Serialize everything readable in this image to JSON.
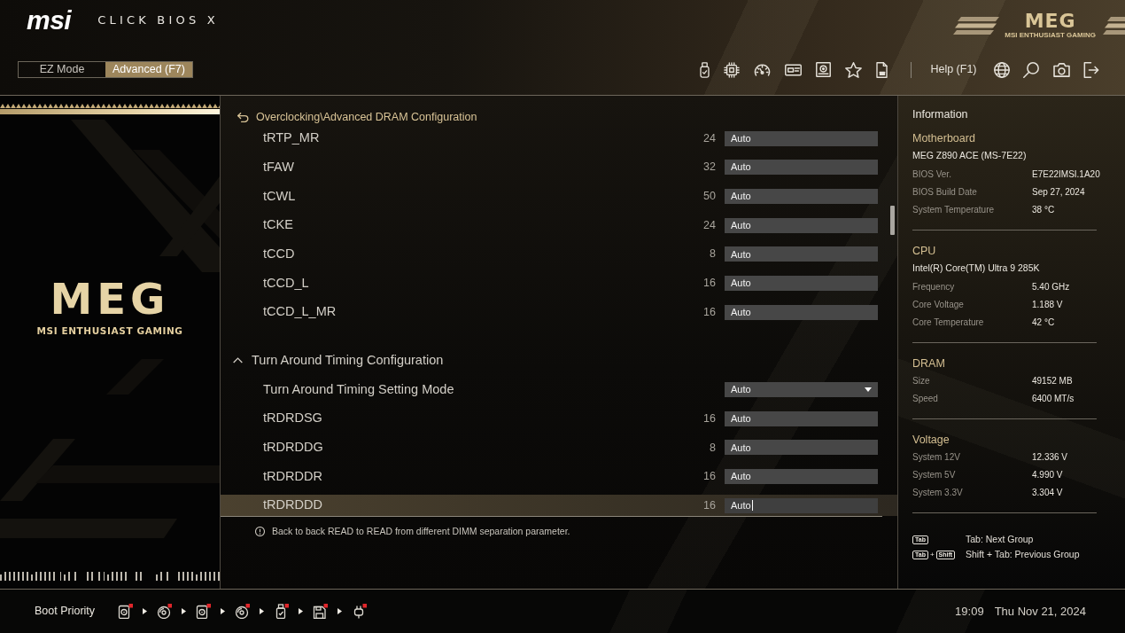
{
  "header": {
    "brand": "msi",
    "product": "CLICK BIOS X",
    "modes": [
      {
        "label": "EZ Mode",
        "selected": false
      },
      {
        "label": "Advanced (F7)",
        "selected": true
      }
    ],
    "help": "Help (F1)",
    "logo": {
      "mark": "MEG",
      "tagline": "MSI ENTHUSIAST GAMING"
    }
  },
  "side_panel": {
    "logo": {
      "mark": "MEG",
      "tagline": "MSI ENTHUSIAST GAMING"
    }
  },
  "breadcrumb": "Overclocking\\Advanced DRAM Configuration",
  "settings": [
    {
      "kind": "value",
      "label": "tRTP_MR",
      "current": "24",
      "value": "Auto",
      "selected": false
    },
    {
      "kind": "value",
      "label": "tFAW",
      "current": "32",
      "value": "Auto",
      "selected": false
    },
    {
      "kind": "value",
      "label": "tCWL",
      "current": "50",
      "value": "Auto",
      "selected": false
    },
    {
      "kind": "value",
      "label": "tCKE",
      "current": "24",
      "value": "Auto",
      "selected": false
    },
    {
      "kind": "value",
      "label": "tCCD",
      "current": "8",
      "value": "Auto",
      "selected": false
    },
    {
      "kind": "value",
      "label": "tCCD_L",
      "current": "16",
      "value": "Auto",
      "selected": false
    },
    {
      "kind": "value",
      "label": "tCCD_L_MR",
      "current": "16",
      "value": "Auto",
      "selected": false
    },
    {
      "kind": "group",
      "label": "Turn Around Timing Configuration",
      "expanded": true,
      "selected": false
    },
    {
      "kind": "dropdown",
      "label": "Turn Around Timing Setting Mode",
      "value": "Auto",
      "selected": false
    },
    {
      "kind": "value",
      "label": "tRDRDSG",
      "current": "16",
      "value": "Auto",
      "selected": false
    },
    {
      "kind": "value",
      "label": "tRDRDDG",
      "current": "8",
      "value": "Auto",
      "selected": false
    },
    {
      "kind": "value",
      "label": "tRDRDDR",
      "current": "16",
      "value": "Auto",
      "selected": false
    },
    {
      "kind": "value",
      "label": "tRDRDDD",
      "current": "16",
      "value": "Auto",
      "selected": true
    }
  ],
  "help_text": "Back to back READ to READ from different DIMM separation parameter.",
  "information": {
    "title": "Information",
    "sections": [
      {
        "title": "Motherboard",
        "subtitle": "MEG Z890 ACE (MS-7E22)",
        "rows": [
          {
            "label": "BIOS Ver.",
            "value": "E7E22IMSI.1A20"
          },
          {
            "label": "BIOS Build Date",
            "value": "Sep 27, 2024"
          },
          {
            "label": "System Temperature",
            "value": "38 °C"
          }
        ]
      },
      {
        "title": "CPU",
        "subtitle": "Intel(R) Core(TM) Ultra 9 285K",
        "rows": [
          {
            "label": "Frequency",
            "value": "5.40 GHz"
          },
          {
            "label": "Core Voltage",
            "value": "1.188 V"
          },
          {
            "label": "Core Temperature",
            "value": "42 °C"
          }
        ]
      },
      {
        "title": "DRAM",
        "rows": [
          {
            "label": "Size",
            "value": "49152 MB"
          },
          {
            "label": "Speed",
            "value": "6400 MT/s"
          }
        ]
      },
      {
        "title": "Voltage",
        "rows": [
          {
            "label": "System 12V",
            "value": "12.336 V"
          },
          {
            "label": "System 5V",
            "value": "4.990 V"
          },
          {
            "label": "System 3.3V",
            "value": "3.304 V"
          }
        ]
      }
    ]
  },
  "shortcuts": [
    {
      "keys": [
        {
          "kind": "key",
          "label": "Tab"
        }
      ],
      "text": "Tab: Next Group"
    },
    {
      "keys": [
        {
          "kind": "key",
          "label": "Tab"
        },
        {
          "kind": "plus",
          "label": "+"
        },
        {
          "kind": "key",
          "label": "Shift"
        }
      ],
      "text": "Shift + Tab: Previous Group"
    }
  ],
  "boot": {
    "label": "Boot Priority",
    "devices": [
      {
        "kind": "hdd"
      },
      {
        "kind": "disc"
      },
      {
        "kind": "hdd"
      },
      {
        "kind": "disc"
      },
      {
        "kind": "usb"
      },
      {
        "kind": "floppy"
      },
      {
        "kind": "plug"
      }
    ]
  },
  "clock": {
    "time": "19:09",
    "date": "Thu Nov 21, 2024"
  }
}
